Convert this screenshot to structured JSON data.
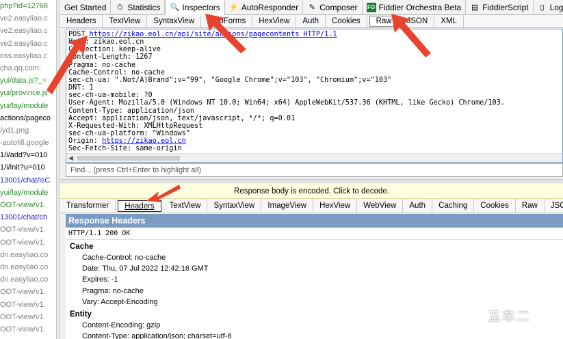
{
  "left_pane": {
    "rows": [
      {
        "text": "php?id=12768",
        "color": "#2a8f2a"
      },
      {
        "text": "ve2.easyliao.c",
        "color": "#808080"
      },
      {
        "text": "ve2.easyliao.c",
        "color": "#808080"
      },
      {
        "text": "ve2.easyliao.c",
        "color": "#808080"
      },
      {
        "text": "oss.easyliao.c",
        "color": "#808080"
      },
      {
        "text": "cha.qq.com:",
        "color": "#808080"
      },
      {
        "text": "yui/data.js?_=",
        "color": "#2a8f2a"
      },
      {
        "text": "yui/province.js",
        "color": "#2a8f2a"
      },
      {
        "text": "yui/lay/module",
        "color": "#2a8f2a"
      },
      {
        "text": "actions/pageco",
        "color": "#000000"
      },
      {
        "text": "/yd1.png",
        "color": "#808080"
      },
      {
        "text": "-autofill.google",
        "color": "#808080"
      },
      {
        "text": "1/i/add?v=010",
        "color": "#000000"
      },
      {
        "text": "1/i/init?u=010",
        "color": "#000000"
      },
      {
        "text": "13001/chat/isC",
        "color": "#2222cc"
      },
      {
        "text": "yui/lay/module",
        "color": "#2a8f2a"
      },
      {
        "text": "OOT-view/v1.",
        "color": "#2a8f2a"
      },
      {
        "text": "13001/chat/ch",
        "color": "#2222cc"
      },
      {
        "text": "OOT-view/v1.",
        "color": "#808080"
      },
      {
        "text": "OOT-view/v1.",
        "color": "#808080"
      },
      {
        "text": "dn.easyliao.co",
        "color": "#808080"
      },
      {
        "text": "dn.easyliao.co",
        "color": "#808080"
      },
      {
        "text": "dn.easyliao.co",
        "color": "#808080"
      },
      {
        "text": "OOT-view/v1.",
        "color": "#808080"
      },
      {
        "text": "OOT-view/v1.",
        "color": "#808080"
      },
      {
        "text": "OOT-view/v1.",
        "color": "#808080"
      },
      {
        "text": "OOT-view/v1.",
        "color": "#808080"
      }
    ]
  },
  "top_tabs": [
    {
      "label": "Get Started",
      "icon": "",
      "active": false
    },
    {
      "label": "Statistics",
      "icon": "timer-icon",
      "active": false
    },
    {
      "label": "Inspectors",
      "icon": "inspector-icon",
      "active": true
    },
    {
      "label": "AutoResponder",
      "icon": "lightning-icon",
      "active": false
    },
    {
      "label": "Composer",
      "icon": "composer-icon",
      "active": false
    },
    {
      "label": "Fiddler Orchestra Beta",
      "icon": "fo-icon",
      "active": false
    },
    {
      "label": "FiddlerScript",
      "icon": "script-icon",
      "active": false
    },
    {
      "label": "Log",
      "icon": "log-icon",
      "active": false
    },
    {
      "label": "",
      "icon": "square-icon",
      "active": false
    }
  ],
  "fo_icon_text": "FO",
  "request_tabs": [
    {
      "label": "Headers",
      "active": false
    },
    {
      "label": "TextView",
      "active": false
    },
    {
      "label": "SyntaxView",
      "active": false
    },
    {
      "label": "WebForms",
      "active": false
    },
    {
      "label": "HexView",
      "active": false
    },
    {
      "label": "Auth",
      "active": false
    },
    {
      "label": "Cookies",
      "active": false
    },
    {
      "label": "Raw",
      "active": true
    },
    {
      "label": "JSON",
      "active": false
    },
    {
      "label": "XML",
      "active": false
    }
  ],
  "raw_request": {
    "method": "POST ",
    "url": "https://zikao.eol.cn/api/site/actions/pagecontents",
    "protocol": " HTTP/1.1",
    "lines": [
      "Host: zikao.eol.cn",
      "Connection: keep-alive",
      "Content-Length: 1267",
      "Pragma: no-cache",
      "Cache-Control: no-cache",
      "sec-ch-ua: \".Not/A)Brand\";v=\"99\", \"Google Chrome\";v=\"103\", \"Chromium\";v=\"103\"",
      "DNT: 1",
      "sec-ch-ua-mobile: ?0",
      "User-Agent: Mozilla/5.0 (Windows NT 10.0; Win64; x64) AppleWebKit/537.36 (KHTML, like Gecko) Chrome/103.",
      "Content-Type: application/json",
      "Accept: application/json, text/javascript, */*; q=0.01",
      "X-Requested-With: XMLHttpRequest",
      "sec-ch-ua-platform: \"Windows\""
    ],
    "origin_label": "Origin: ",
    "origin_url": "https://zikao.eol.cn",
    "fetch_site": "Sec-Fetch-Site: same-origin"
  },
  "find_placeholder": "Find... (press Ctrl+Enter to highlight all)",
  "encoded_notice": "Response body is encoded. Click to decode.",
  "response_tabs": [
    {
      "label": "Transformer",
      "active": false
    },
    {
      "label": "Headers",
      "active": true
    },
    {
      "label": "TextView",
      "active": false
    },
    {
      "label": "SyntaxView",
      "active": false
    },
    {
      "label": "ImageView",
      "active": false
    },
    {
      "label": "HexView",
      "active": false
    },
    {
      "label": "WebView",
      "active": false
    },
    {
      "label": "Auth",
      "active": false
    },
    {
      "label": "Caching",
      "active": false
    },
    {
      "label": "Cookies",
      "active": false
    },
    {
      "label": "Raw",
      "active": false
    },
    {
      "label": "JSO",
      "active": false
    }
  ],
  "response_headers": {
    "title": "Response Headers",
    "status_line": "HTTP/1.1 200 OK",
    "groups": [
      {
        "name": "Cache",
        "items": [
          "Cache-Control: no-cache",
          "Date: Thu, 07 Jul 2022 12:42:16 GMT",
          "Expires: -1",
          "Pragma: no-cache",
          "Vary: Accept-Encoding"
        ]
      },
      {
        "name": "Entity",
        "items": [
          "Content-Encoding: gzip",
          "Content-Type: application/json; charset=utf-8"
        ]
      }
    ]
  },
  "watermark": "五车二",
  "colors": {
    "arrow": "#e8432f",
    "header_bar": "#7b9bc2",
    "link": "#0000ee"
  }
}
